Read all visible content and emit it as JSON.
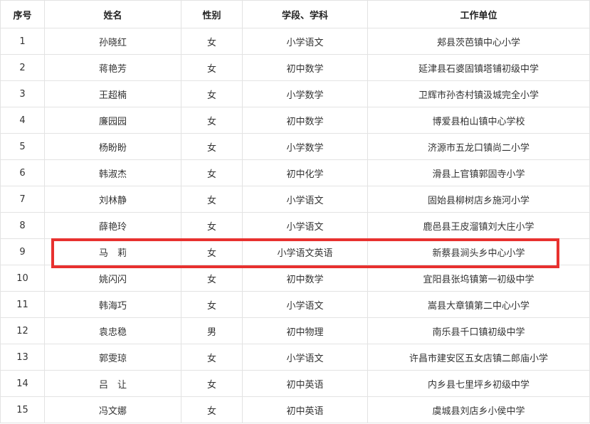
{
  "table": {
    "headers": [
      "序号",
      "姓名",
      "性别",
      "学段、学科",
      "工作单位"
    ],
    "rows": [
      [
        "1",
        "孙晓红",
        "女",
        "小学语文",
        "郏县茨芭镇中心小学"
      ],
      [
        "2",
        "蒋艳芳",
        "女",
        "初中数学",
        "延津县石婆固镇塔铺初级中学"
      ],
      [
        "3",
        "王超楠",
        "女",
        "小学数学",
        "卫辉市孙杏村镇汲城完全小学"
      ],
      [
        "4",
        "廉园园",
        "女",
        "初中数学",
        "博爱县柏山镇中心学校"
      ],
      [
        "5",
        "杨盼盼",
        "女",
        "小学数学",
        "济源市五龙口镇尚二小学"
      ],
      [
        "6",
        "韩淑杰",
        "女",
        "初中化学",
        "滑县上官镇郭固寺小学"
      ],
      [
        "7",
        "刘林静",
        "女",
        "小学语文",
        "固始县柳树店乡施河小学"
      ],
      [
        "8",
        "薛艳玲",
        "女",
        "小学语文",
        "鹿邑县王皮溜镇刘大庄小学"
      ],
      [
        "9",
        "马　莉",
        "女",
        "小学语文英语",
        "新蔡县涧头乡中心小学"
      ],
      [
        "10",
        "姚闪闪",
        "女",
        "初中数学",
        "宜阳县张坞镇第一初级中学"
      ],
      [
        "11",
        "韩海巧",
        "女",
        "小学语文",
        "嵩县大章镇第二中心小学"
      ],
      [
        "12",
        "袁忠稳",
        "男",
        "初中物理",
        "南乐县千口镇初级中学"
      ],
      [
        "13",
        "郭雯琼",
        "女",
        "小学语文",
        "许昌市建安区五女店镇二郎庙小学"
      ],
      [
        "14",
        "吕　让",
        "女",
        "初中英语",
        "内乡县七里坪乡初级中学"
      ],
      [
        "15",
        "冯文娜",
        "女",
        "初中英语",
        "虞城县刘店乡小侯中学"
      ]
    ]
  },
  "highlight": {
    "row_index": 9,
    "color": "#e8312f"
  }
}
